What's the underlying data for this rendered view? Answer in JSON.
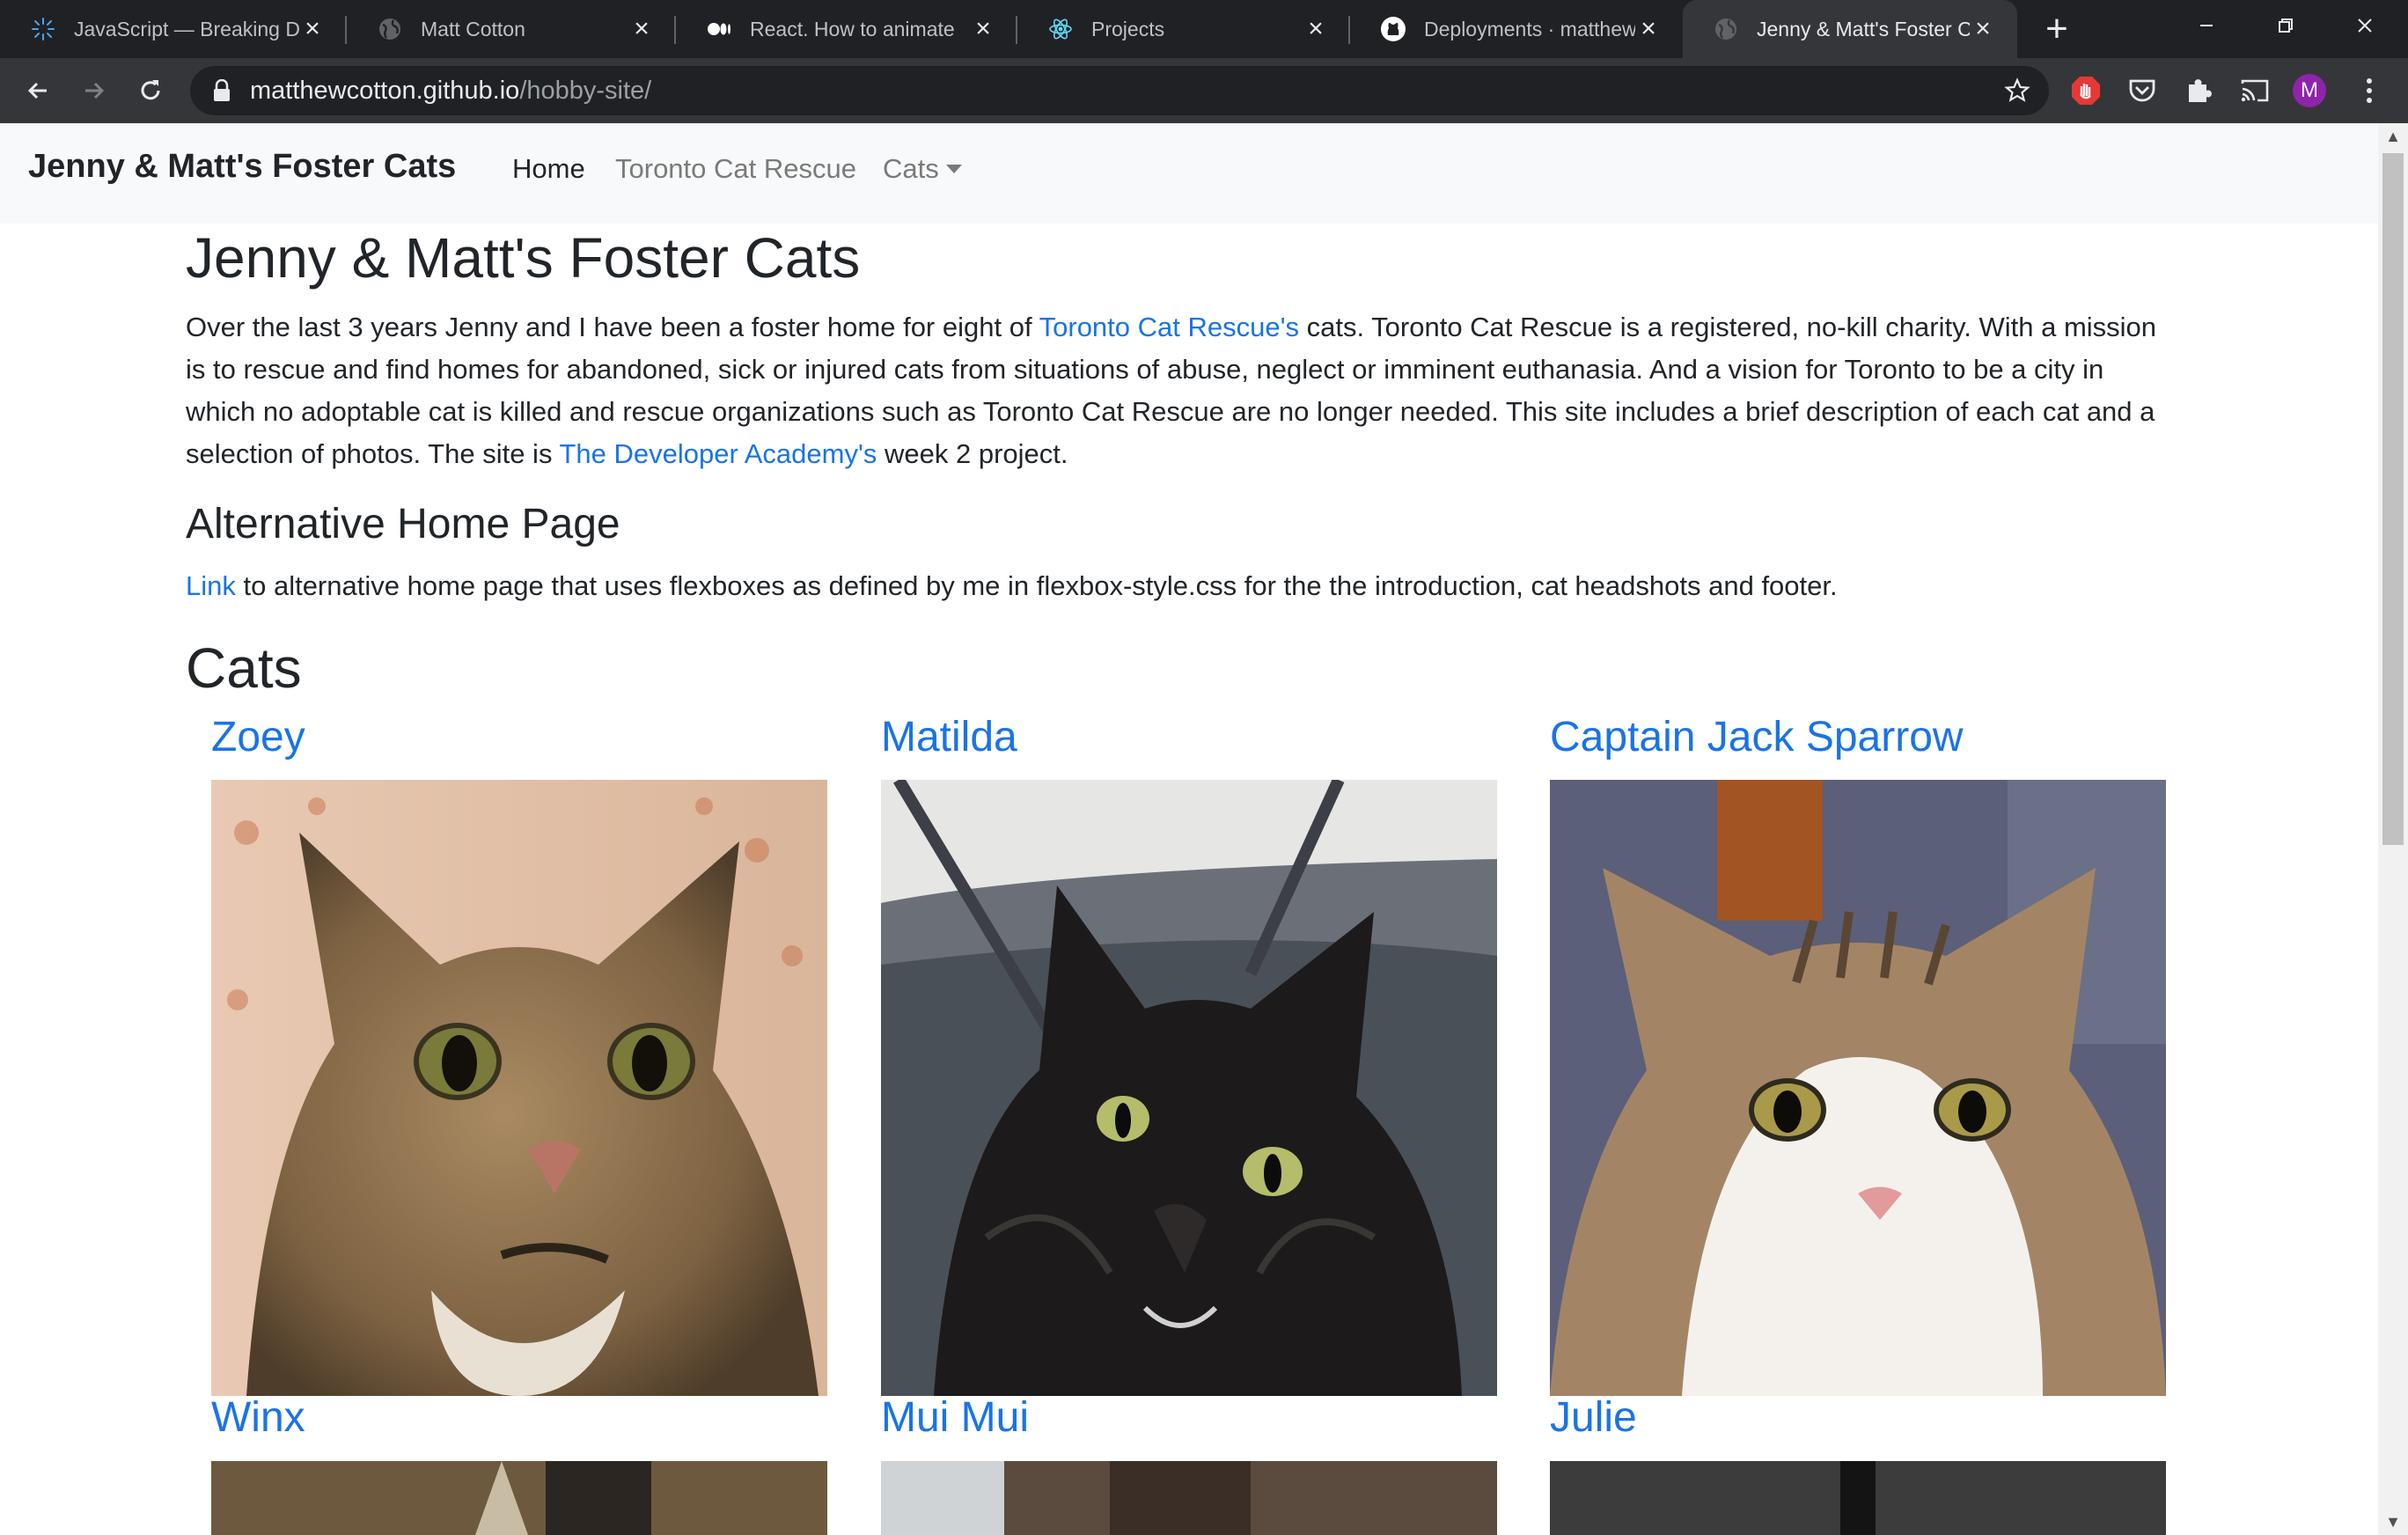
{
  "browser": {
    "tabs": [
      {
        "title": "JavaScript — Breaking D",
        "icon": "spark-logo-icon"
      },
      {
        "title": "Matt Cotton",
        "icon": "globe-icon"
      },
      {
        "title": "React. How to animate",
        "icon": "medium-logo-icon"
      },
      {
        "title": "Projects",
        "icon": "react-logo-icon"
      },
      {
        "title": "Deployments · matthew",
        "icon": "github-logo-icon"
      },
      {
        "title": "Jenny & Matt's Foster C",
        "icon": "globe-icon",
        "active": true
      }
    ],
    "url_host": "matthewcotton.github.io",
    "url_path": "/hobby-site/",
    "profile_initial": "M"
  },
  "site": {
    "brand": "Jenny & Matt's Foster Cats",
    "nav": {
      "home": "Home",
      "rescue": "Toronto Cat Rescue",
      "cats": "Cats"
    },
    "title": "Jenny & Matt's Foster Cats",
    "intro": {
      "line1_pre": "Over the last 3 years Jenny and I have been a foster home for eight of ",
      "link_rescue": "Toronto Cat Rescue's",
      "line1_post": " cats. Toronto Cat Rescue is a registered, no-kill charity. With a mission",
      "line2": "is to rescue and find homes for abandoned, sick or injured cats from situations of abuse, neglect or imminent euthanasia. And a vision for Toronto to be a city in",
      "line3": "which no adoptable cat is killed and rescue organizations such as Toronto Cat Rescue are no longer needed. This site includes a brief description of each cat and a",
      "line4_pre": "selection of photos. The site is ",
      "link_academy": "The Developer Academy's",
      "line4_post": " week 2 project."
    },
    "alt": {
      "heading": "Alternative Home Page",
      "link": "Link",
      "text": " to alternative home page that uses flexboxes as defined by me in flexbox-style.css for the the introduction, cat headshots and footer."
    },
    "cats_heading": "Cats",
    "cats": [
      {
        "name": "Zoey"
      },
      {
        "name": "Matilda"
      },
      {
        "name": "Captain Jack Sparrow"
      },
      {
        "name": "Winx"
      },
      {
        "name": "Mui Mui"
      },
      {
        "name": "Julie"
      }
    ]
  },
  "colors": {
    "link": "#1a73e8",
    "text": "#212529",
    "navbar_bg": "#f8f9fa",
    "chrome_dark": "#202124",
    "chrome_toolbar": "#35363a"
  }
}
